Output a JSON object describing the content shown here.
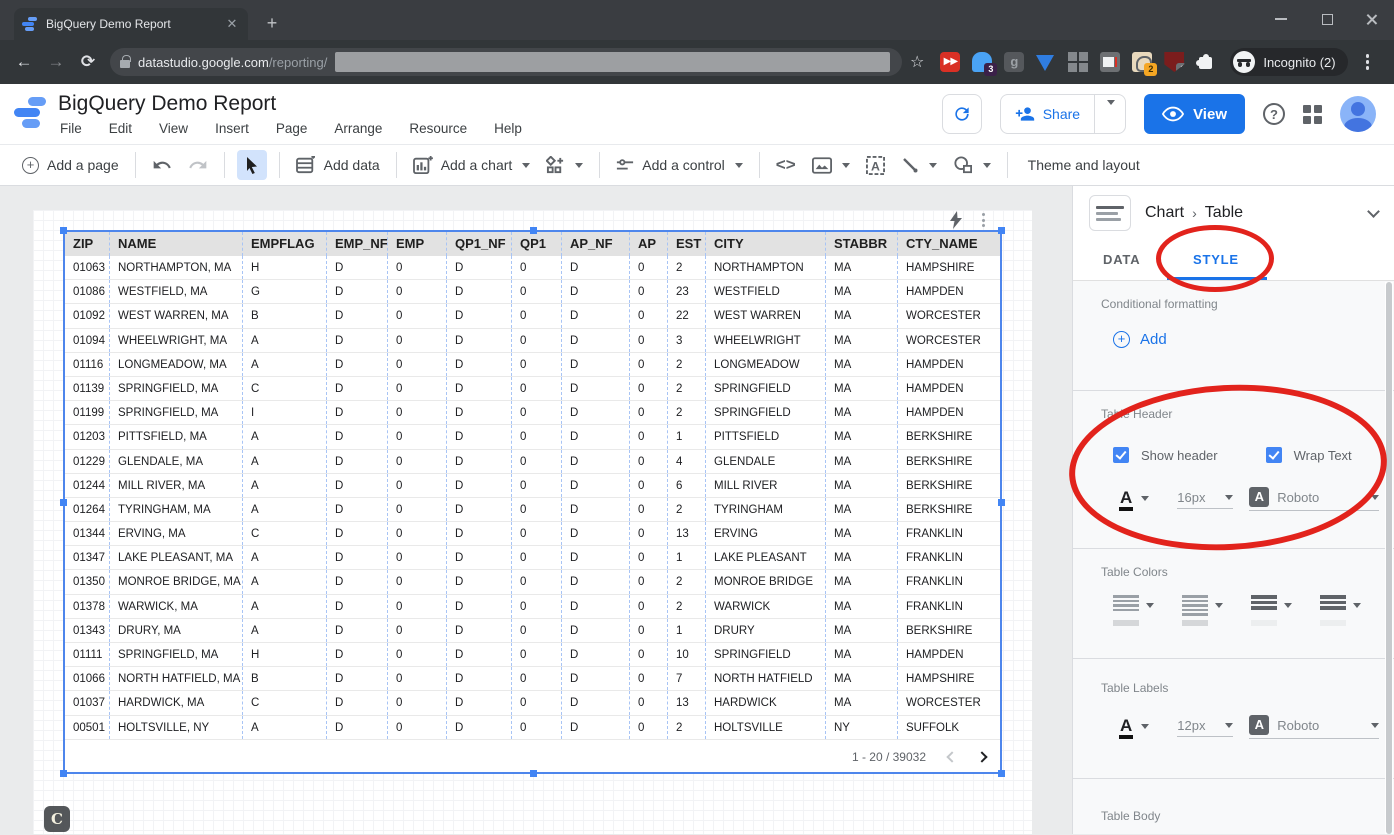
{
  "browser": {
    "tab_title": "BigQuery Demo Report",
    "new_tab": "+",
    "url_domain": "datastudio.google.com",
    "url_path": "/reporting/",
    "incognito_label": "Incognito (2)",
    "ext_badges": {
      "ghost": "3",
      "draw": "2",
      "ublock": "3"
    }
  },
  "header": {
    "title": "BigQuery Demo Report",
    "menus": [
      "File",
      "Edit",
      "View",
      "Insert",
      "Page",
      "Arrange",
      "Resource",
      "Help"
    ],
    "share_label": "Share",
    "view_label": "View"
  },
  "toolbar": {
    "add_page": "Add a page",
    "add_data": "Add data",
    "add_chart": "Add a chart",
    "add_control": "Add a control",
    "theme_layout": "Theme and layout"
  },
  "table": {
    "columns": [
      "ZIP",
      "NAME",
      "EMPFLAG",
      "EMP_NF",
      "EMP",
      "QP1_NF",
      "QP1",
      "AP_NF",
      "AP",
      "EST",
      "CITY",
      "STABBR",
      "CTY_NAME"
    ],
    "rows": [
      [
        "01063",
        "NORTHAMPTON, MA",
        "H",
        "D",
        "0",
        "D",
        "0",
        "D",
        "0",
        "2",
        "NORTHAMPTON",
        "MA",
        "HAMPSHIRE"
      ],
      [
        "01086",
        "WESTFIELD, MA",
        "G",
        "D",
        "0",
        "D",
        "0",
        "D",
        "0",
        "23",
        "WESTFIELD",
        "MA",
        "HAMPDEN"
      ],
      [
        "01092",
        "WEST WARREN, MA",
        "B",
        "D",
        "0",
        "D",
        "0",
        "D",
        "0",
        "22",
        "WEST WARREN",
        "MA",
        "WORCESTER"
      ],
      [
        "01094",
        "WHEELWRIGHT, MA",
        "A",
        "D",
        "0",
        "D",
        "0",
        "D",
        "0",
        "3",
        "WHEELWRIGHT",
        "MA",
        "WORCESTER"
      ],
      [
        "01116",
        "LONGMEADOW, MA",
        "A",
        "D",
        "0",
        "D",
        "0",
        "D",
        "0",
        "2",
        "LONGMEADOW",
        "MA",
        "HAMPDEN"
      ],
      [
        "01139",
        "SPRINGFIELD, MA",
        "C",
        "D",
        "0",
        "D",
        "0",
        "D",
        "0",
        "2",
        "SPRINGFIELD",
        "MA",
        "HAMPDEN"
      ],
      [
        "01199",
        "SPRINGFIELD, MA",
        "I",
        "D",
        "0",
        "D",
        "0",
        "D",
        "0",
        "2",
        "SPRINGFIELD",
        "MA",
        "HAMPDEN"
      ],
      [
        "01203",
        "PITTSFIELD, MA",
        "A",
        "D",
        "0",
        "D",
        "0",
        "D",
        "0",
        "1",
        "PITTSFIELD",
        "MA",
        "BERKSHIRE"
      ],
      [
        "01229",
        "GLENDALE, MA",
        "A",
        "D",
        "0",
        "D",
        "0",
        "D",
        "0",
        "4",
        "GLENDALE",
        "MA",
        "BERKSHIRE"
      ],
      [
        "01244",
        "MILL RIVER, MA",
        "A",
        "D",
        "0",
        "D",
        "0",
        "D",
        "0",
        "6",
        "MILL RIVER",
        "MA",
        "BERKSHIRE"
      ],
      [
        "01264",
        "TYRINGHAM, MA",
        "A",
        "D",
        "0",
        "D",
        "0",
        "D",
        "0",
        "2",
        "TYRINGHAM",
        "MA",
        "BERKSHIRE"
      ],
      [
        "01344",
        "ERVING, MA",
        "C",
        "D",
        "0",
        "D",
        "0",
        "D",
        "0",
        "13",
        "ERVING",
        "MA",
        "FRANKLIN"
      ],
      [
        "01347",
        "LAKE PLEASANT, MA",
        "A",
        "D",
        "0",
        "D",
        "0",
        "D",
        "0",
        "1",
        "LAKE PLEASANT",
        "MA",
        "FRANKLIN"
      ],
      [
        "01350",
        "MONROE BRIDGE, MA",
        "A",
        "D",
        "0",
        "D",
        "0",
        "D",
        "0",
        "2",
        "MONROE BRIDGE",
        "MA",
        "FRANKLIN"
      ],
      [
        "01378",
        "WARWICK, MA",
        "A",
        "D",
        "0",
        "D",
        "0",
        "D",
        "0",
        "2",
        "WARWICK",
        "MA",
        "FRANKLIN"
      ],
      [
        "01343",
        "DRURY, MA",
        "A",
        "D",
        "0",
        "D",
        "0",
        "D",
        "0",
        "1",
        "DRURY",
        "MA",
        "BERKSHIRE"
      ],
      [
        "01111",
        "SPRINGFIELD, MA",
        "H",
        "D",
        "0",
        "D",
        "0",
        "D",
        "0",
        "10",
        "SPRINGFIELD",
        "MA",
        "HAMPDEN"
      ],
      [
        "01066",
        "NORTH HATFIELD, MA",
        "B",
        "D",
        "0",
        "D",
        "0",
        "D",
        "0",
        "7",
        "NORTH HATFIELD",
        "MA",
        "HAMPSHIRE"
      ],
      [
        "01037",
        "HARDWICK, MA",
        "C",
        "D",
        "0",
        "D",
        "0",
        "D",
        "0",
        "13",
        "HARDWICK",
        "MA",
        "WORCESTER"
      ],
      [
        "00501",
        "HOLTSVILLE, NY",
        "A",
        "D",
        "0",
        "D",
        "0",
        "D",
        "0",
        "2",
        "HOLTSVILLE",
        "NY",
        "SUFFOLK"
      ]
    ],
    "pagination": "1 - 20 / 39032"
  },
  "panel": {
    "breadcrumb": [
      "Chart",
      "Table"
    ],
    "tabs": [
      "DATA",
      "STYLE"
    ],
    "active_tab": "STYLE",
    "conditional": {
      "label": "Conditional formatting",
      "add_label": "Add"
    },
    "table_header": {
      "label": "Table Header",
      "show_header": "Show header",
      "wrap_text": "Wrap Text",
      "show_header_checked": true,
      "wrap_text_checked": true,
      "font_size": "16px",
      "font_family": "Roboto"
    },
    "table_colors": {
      "label": "Table Colors"
    },
    "table_labels": {
      "label": "Table Labels",
      "font_size": "12px",
      "font_family": "Roboto"
    },
    "table_body": {
      "label": "Table Body"
    }
  },
  "colors": {
    "accent_blue": "#1a73e8",
    "selection_blue": "#4285f4",
    "annotation_red": "#e2231c",
    "header_row_bg": "#e2e2e2",
    "panel_bg": "#f8f9fa"
  },
  "overlay": {
    "badge": "C"
  }
}
